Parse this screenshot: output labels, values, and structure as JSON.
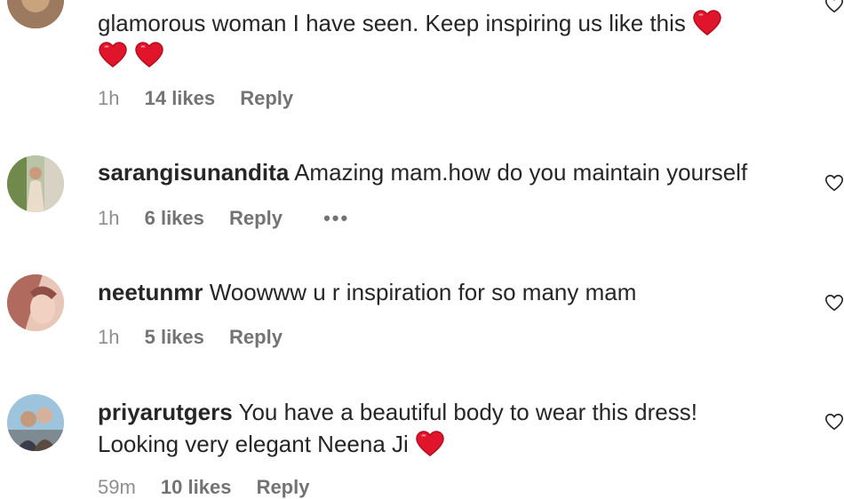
{
  "comments": [
    {
      "text_line1": "glamorous woman I have seen. Keep inspiring us like this",
      "time": "1h",
      "likes": "14 likes",
      "reply": "Reply",
      "emoji": "red-heart"
    },
    {
      "username": "sarangisunandita",
      "text": "Amazing mam.how do you maintain yourself",
      "time": "1h",
      "likes": "6 likes",
      "reply": "Reply",
      "more": "•••"
    },
    {
      "username": "neetunmr",
      "text": "Woowww u r inspiration for so many mam",
      "time": "1h",
      "likes": "5 likes",
      "reply": "Reply"
    },
    {
      "username": "priyarutgers",
      "text_line1": "You have a beautiful body to wear this dress!",
      "text_line2": "Looking very elegant Neena Ji",
      "time": "59m",
      "likes": "10 likes",
      "reply": "Reply",
      "emoji": "red-heart"
    }
  ],
  "colors": {
    "text": "#262626",
    "meta": "#8e8e8e",
    "heart": "#e0142a"
  },
  "icons": {
    "like": "heart-outline-icon",
    "emoji": "heart-emoji-icon"
  }
}
